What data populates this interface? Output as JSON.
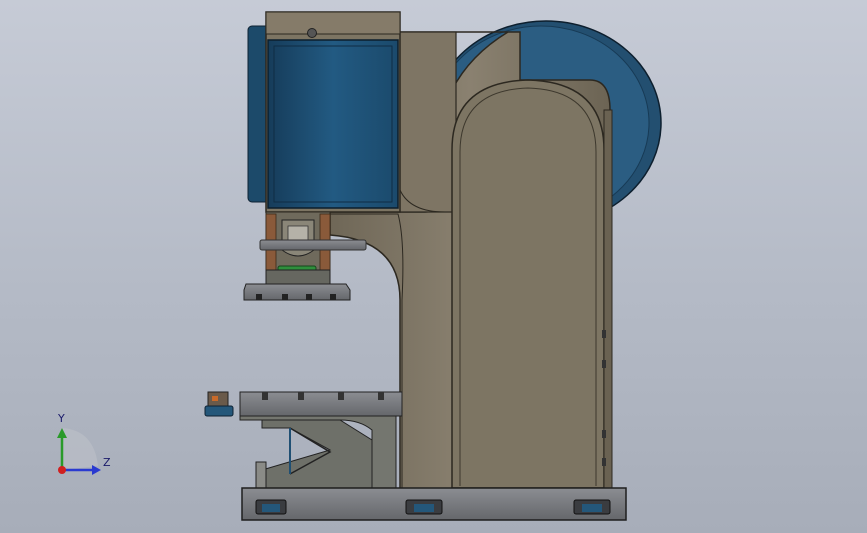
{
  "viewport": {
    "background_top": "#c6cbd6",
    "background_bottom": "#a7adb9"
  },
  "model": {
    "frame_color": "#7c7362",
    "frame_dark": "#5a5346",
    "steel_color": "#7a7c80",
    "motor_color": "#1f4f73",
    "flywheel_color": "#24577a",
    "accent_green": "#2f8f3c",
    "accent_orange": "#b85a2a"
  },
  "triad": {
    "y_label": "Y",
    "z_label": "Z",
    "y_color": "#2a9a2a",
    "z_color": "#2a3ad0",
    "x_color": "#d02020"
  }
}
